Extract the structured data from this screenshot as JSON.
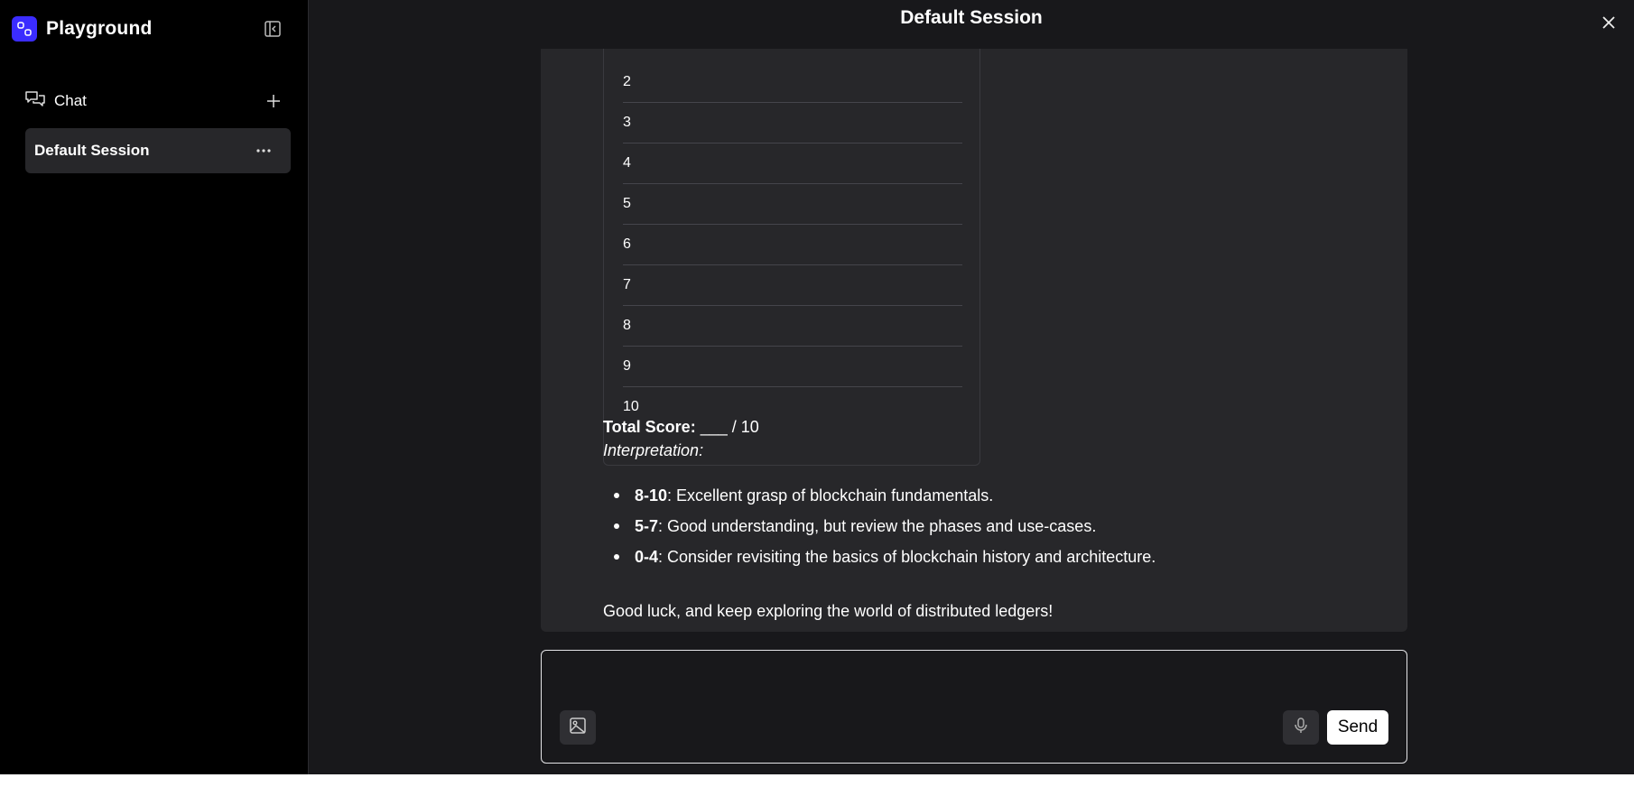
{
  "sidebar": {
    "brand": "Playground",
    "collapse_icon": "sidebar-collapse-icon",
    "chat_label": "Chat",
    "sessions": [
      {
        "label": "Default Session"
      }
    ]
  },
  "header": {
    "title": "Default Session"
  },
  "message": {
    "table_rows": [
      "2",
      "3",
      "4",
      "5",
      "6",
      "7",
      "8",
      "9",
      "10"
    ],
    "score_label": "Total Score:",
    "score_value": "___ / 10",
    "interpretation_label": "Interpretation:",
    "bullets": [
      {
        "range": "8-10",
        "text": ": Excellent grasp of blockchain fundamentals."
      },
      {
        "range": "5-7",
        "text": ": Good understanding, but review the phases and use-cases."
      },
      {
        "range": "0-4",
        "text": ": Consider revisiting the basics of blockchain history and architecture."
      }
    ],
    "closing": "Good luck, and keep exploring the world of distributed ledgers!"
  },
  "composer": {
    "value": "",
    "placeholder": "",
    "send_label": "Send"
  },
  "colors": {
    "brand": "#3b2cff",
    "background": "#18181b",
    "panel": "#27272a"
  }
}
